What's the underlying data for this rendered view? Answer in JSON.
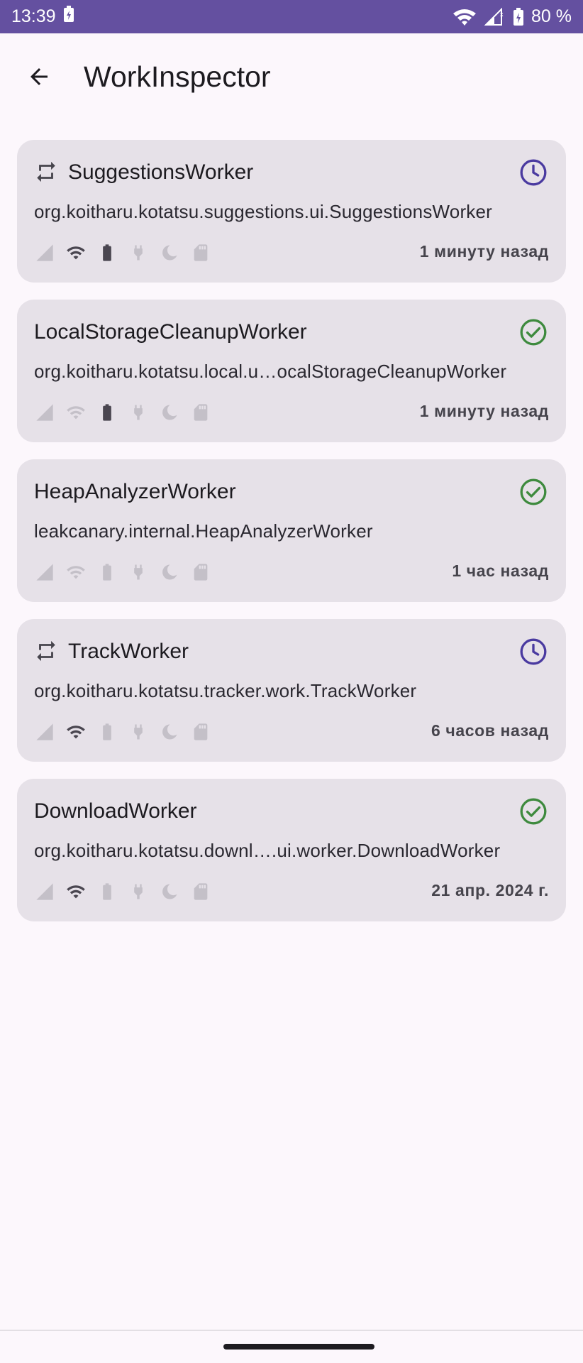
{
  "status_bar": {
    "time": "13:39",
    "battery": "80 %",
    "bg_color": "#6450a0"
  },
  "app_bar": {
    "title": "WorkInspector",
    "back_icon": "arrow-back-icon"
  },
  "colors": {
    "card_bg": "#e6e1e8",
    "enqueued": "#4a3aa0",
    "succeeded": "#3e8a3e",
    "constraint_active": "#4a4650",
    "constraint_inactive": "#c4c0c8"
  },
  "workers": [
    {
      "name": "SuggestionsWorker",
      "periodic": true,
      "state": "enqueued",
      "state_icon": "clock-icon",
      "class": "org.koitharu.kotatsu.suggestions.ui.SuggestionsWorker",
      "time": "1 минуту назад",
      "constraints": {
        "network_metered": false,
        "network": true,
        "battery": true,
        "charging": false,
        "idle": false,
        "storage": false
      }
    },
    {
      "name": "LocalStorageCleanupWorker",
      "periodic": false,
      "state": "succeeded",
      "state_icon": "check-circle-icon",
      "class": "org.koitharu.kotatsu.local.u…ocalStorageCleanupWorker",
      "time": "1 минуту назад",
      "constraints": {
        "network_metered": false,
        "network": false,
        "battery": true,
        "charging": false,
        "idle": false,
        "storage": false
      }
    },
    {
      "name": "HeapAnalyzerWorker",
      "periodic": false,
      "state": "succeeded",
      "state_icon": "check-circle-icon",
      "class": "leakcanary.internal.HeapAnalyzerWorker",
      "time": "1 час назад",
      "constraints": {
        "network_metered": false,
        "network": false,
        "battery": false,
        "charging": false,
        "idle": false,
        "storage": false
      }
    },
    {
      "name": "TrackWorker",
      "periodic": true,
      "state": "enqueued",
      "state_icon": "clock-icon",
      "class": "org.koitharu.kotatsu.tracker.work.TrackWorker",
      "time": "6 часов назад",
      "constraints": {
        "network_metered": false,
        "network": true,
        "battery": false,
        "charging": false,
        "idle": false,
        "storage": false
      }
    },
    {
      "name": "DownloadWorker",
      "periodic": false,
      "state": "succeeded",
      "state_icon": "check-circle-icon",
      "class": "org.koitharu.kotatsu.downl….ui.worker.DownloadWorker",
      "time": "21 апр. 2024 г.",
      "constraints": {
        "network_metered": false,
        "network": true,
        "battery": false,
        "charging": false,
        "idle": false,
        "storage": false
      }
    }
  ]
}
